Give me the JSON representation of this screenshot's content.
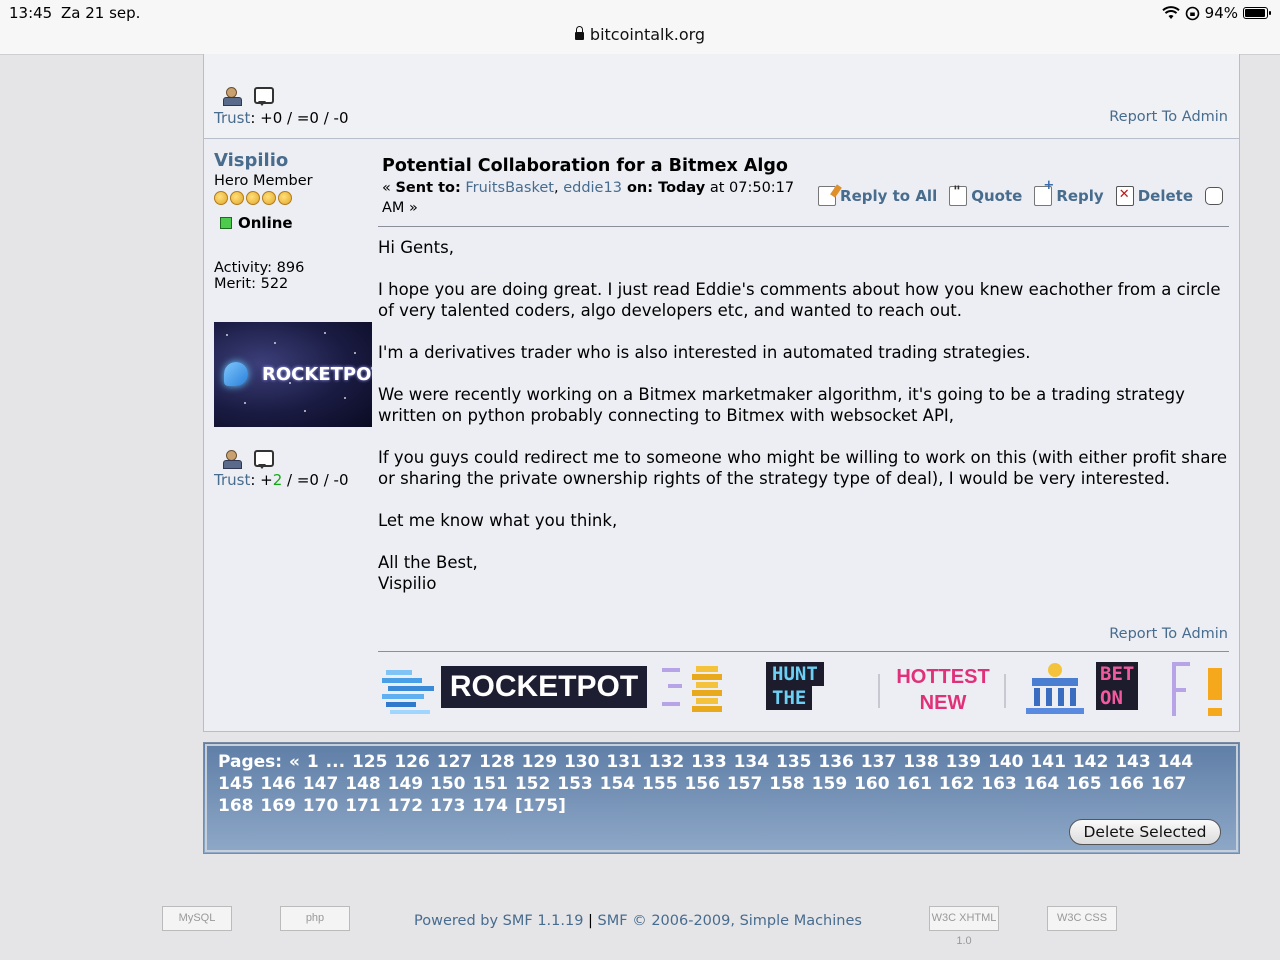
{
  "status_bar": {
    "time": "13:45",
    "date": "Za 21 sep.",
    "battery": "94%",
    "battery_level": 0.94
  },
  "address_bar": {
    "url": "bitcointalk.org"
  },
  "prev_post": {
    "trust_label": "Trust",
    "trust_values": ": +0 / =0 / -0",
    "report": "Report To Admin"
  },
  "post": {
    "author": "Vispilio",
    "rank": "Hero Member",
    "stars": 5,
    "status": "Online",
    "activity": "Activity: 896",
    "merit": "Merit: 522",
    "avatar_text": "ROCKETPOT",
    "trust_label": "Trust",
    "trust_prefix": ": +",
    "trust_pos": "2",
    "trust_rest": " / =0 / -0",
    "subject": "Potential Collaboration for a Bitmex Algo",
    "sent_prefix": "« ",
    "sent_label": "Sent to:",
    "recipient_1": "FruitsBasket",
    "recipient_sep": ", ",
    "recipient_2": "eddie13",
    "on_label": " on:",
    "today": " Today",
    "time_text": " at 07:50:17 AM »",
    "actions": {
      "reply_all": "Reply to All",
      "quote": "Quote",
      "reply": "Reply",
      "delete": "Delete"
    },
    "body": [
      "Hi Gents,",
      "I hope you are doing great. I just read Eddie's comments about how you knew eachother from a circle of very talented coders, algo developers etc, and wanted to reach out.",
      "I'm a derivatives trader who is also interested in automated trading strategies.",
      "We were recently working on a Bitmex marketmaker algorithm, it's going to be a trading strategy written on python probably connecting to Bitmex with websocket API,",
      "If you guys could redirect me to someone who might be willing to work on this (with either profit share or sharing the private ownership rights of the strategy type of deal), I would be very interested.",
      "Let me know what you think,",
      "All the Best,",
      "Vispilio"
    ],
    "report": "Report To Admin",
    "signature": {
      "brand": "ROCKETPOT",
      "hunt_1": "HUNT",
      "hunt_2": "THE",
      "hot_1": "HOTTEST",
      "hot_2": "NEW",
      "bet_1": "BET",
      "bet_2": "ON"
    }
  },
  "pagination": {
    "label": "Pages: « 1 ... 125 126 127 128 129 130 131 132 133 134 135 136 137 138 139 140 141 142 143 144 145 146 147 148 149 150 151 152 153 154 155 156 157 158 159 160 161 162 163 164 165 166 167 168 169 170 171 172 173 174 [175]",
    "delete_selected": "Delete Selected"
  },
  "footer": {
    "powered": "Powered by SMF 1.1.19",
    "divider": " | ",
    "copyright": "SMF © 2006-2009, Simple Machines",
    "badge_mysql": "MySQL",
    "badge_php": "php",
    "badge_xhtml": "W3C XHTML 1.0",
    "badge_css": "W3C CSS"
  },
  "colors": {
    "link": "#476c8e",
    "pages_bg": "#6f8cb3",
    "trust_positive": "#14a814"
  }
}
